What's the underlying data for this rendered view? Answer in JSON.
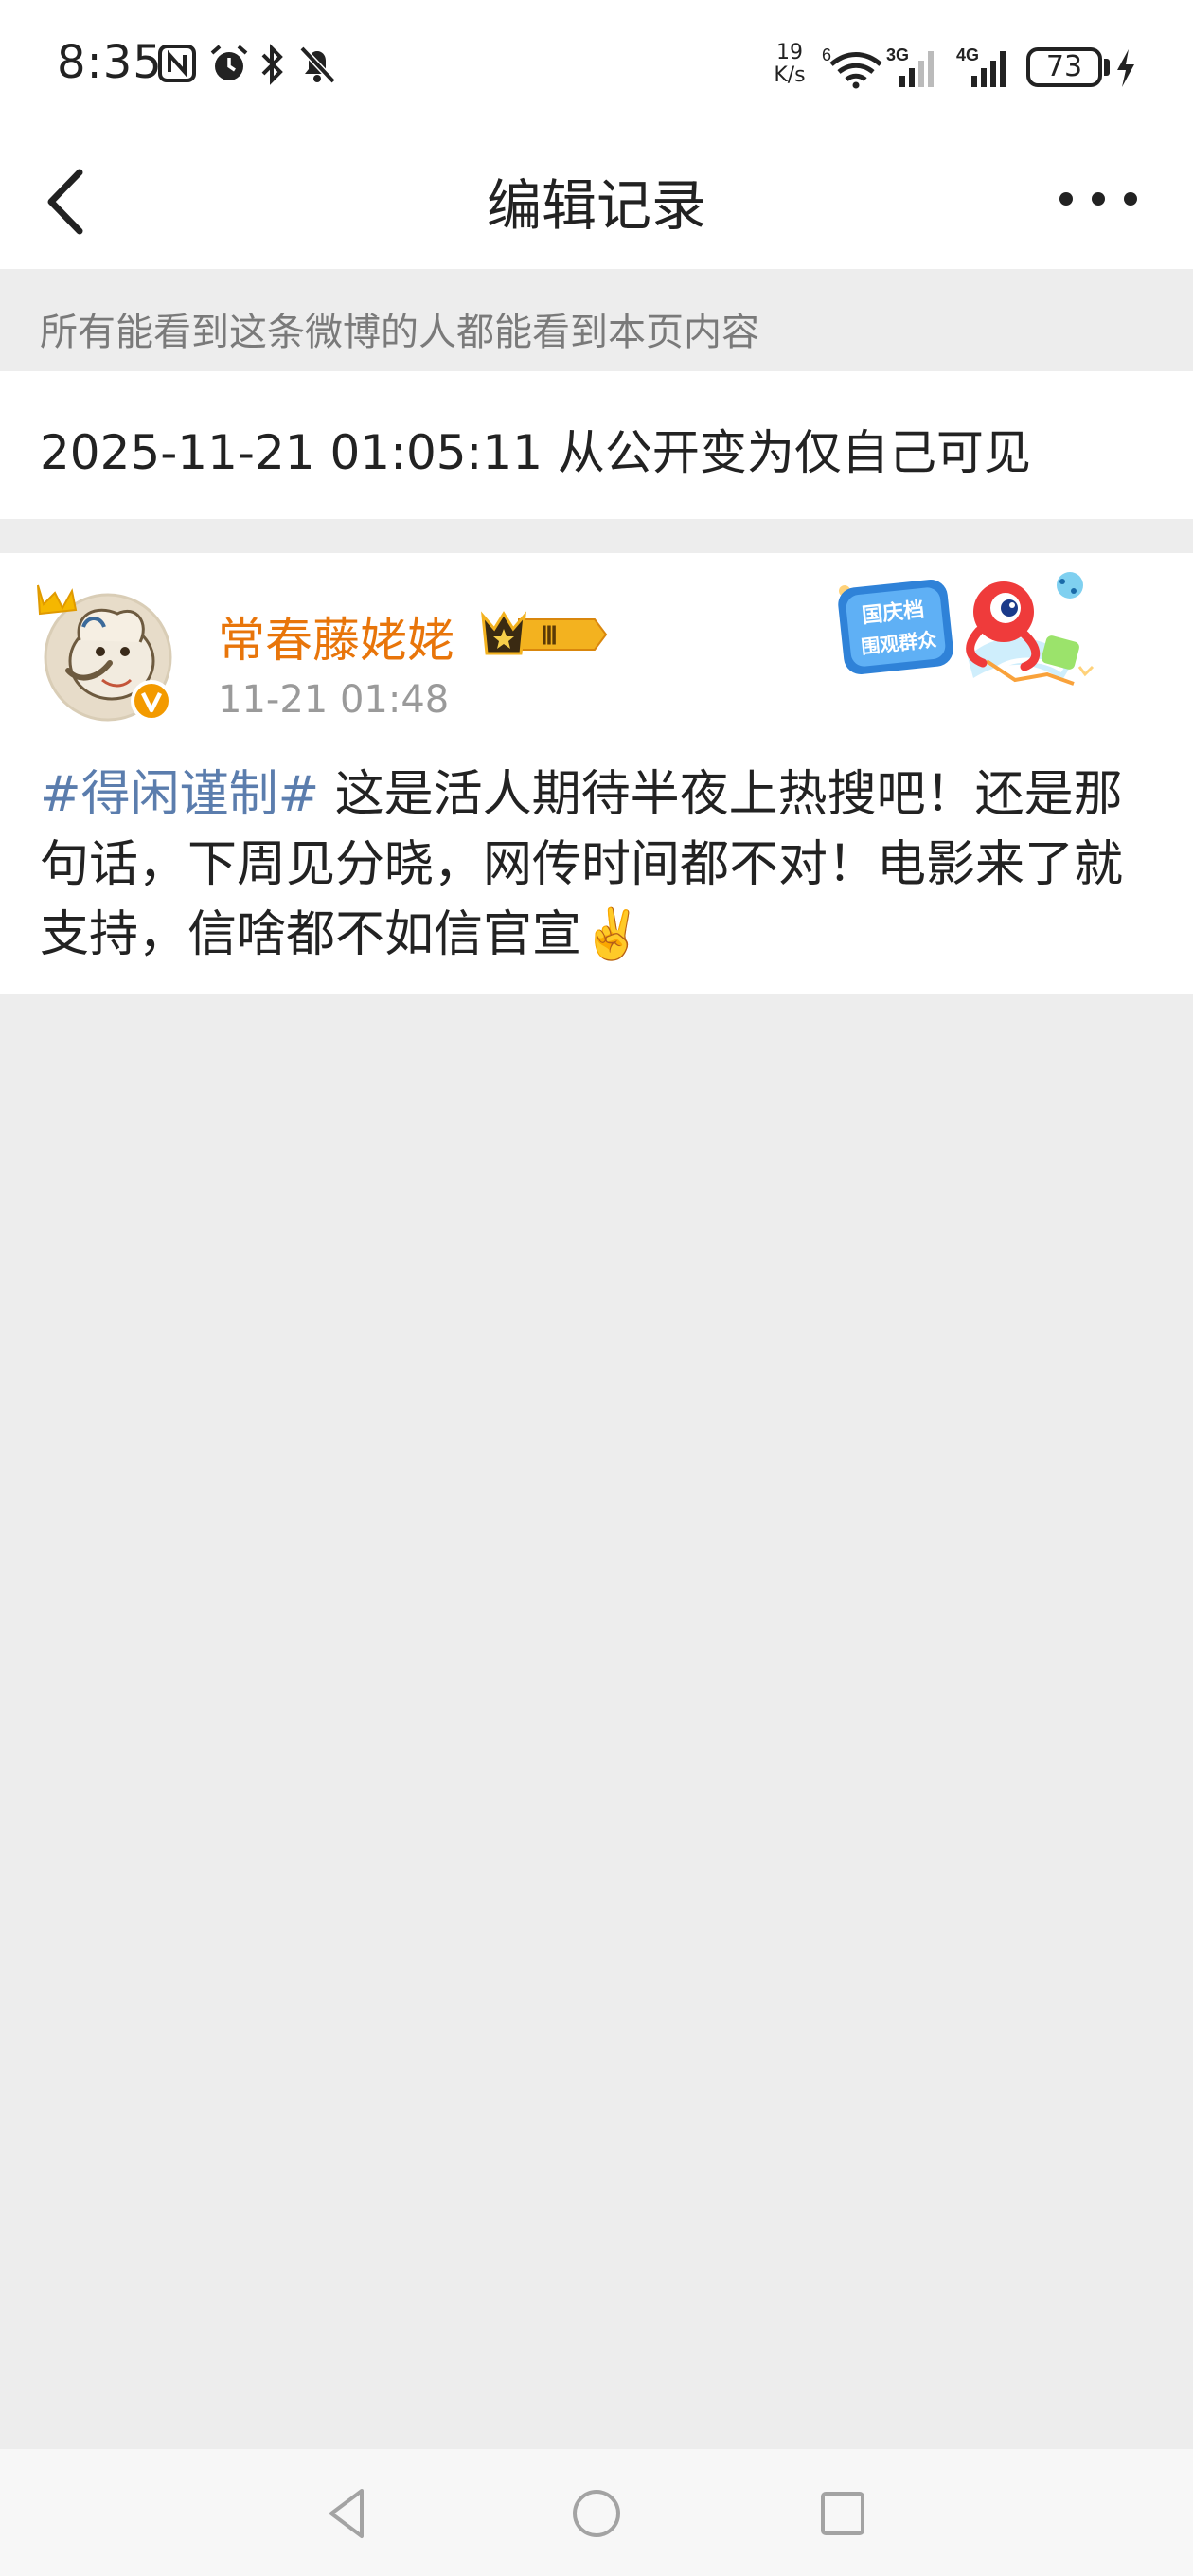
{
  "status_bar": {
    "time": "8:35",
    "net_speed_value": "19",
    "net_speed_unit": "K/s",
    "wifi_label": "6",
    "signal_1_label": "3G",
    "signal_2_label": "4G",
    "battery_level": "73"
  },
  "nav": {
    "title": "编辑记录"
  },
  "notice": {
    "text": "所有能看到这条微博的人都能看到本页内容"
  },
  "record": {
    "text": "2025-11-21 01:05:11 从公开变为仅自己可见"
  },
  "post": {
    "username": "常春藤姥姥",
    "level_label": "Ⅲ",
    "time": "11-21 01:48",
    "hashtag": "#得闲谨制#",
    "body": " 这是活人期待半夜上热搜吧！还是那句话，下周见分晓，网传时间都不对！电影来了就支持，信啥都不如信官宣✌️",
    "decoration_text_1": "国庆档",
    "decoration_text_2": "围观群众"
  },
  "colors": {
    "username": "#e8750a",
    "hashtag": "#5b7dad",
    "background": "#ededed"
  }
}
